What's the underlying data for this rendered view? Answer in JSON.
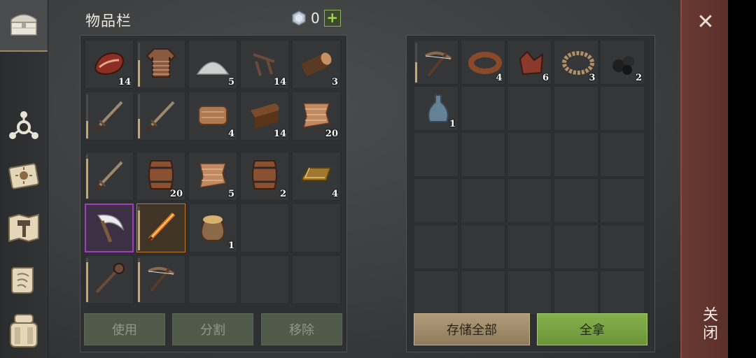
{
  "sidebar": {
    "items": [
      {
        "icon": "chest-icon"
      },
      {
        "icon": "perks-icon"
      },
      {
        "icon": "sun-journal-icon"
      },
      {
        "icon": "crafting-map-icon"
      },
      {
        "icon": "scroll-icon"
      },
      {
        "icon": "backpack-icon"
      }
    ]
  },
  "inventory": {
    "title": "物品栏",
    "currency": {
      "icon": "gem-icon",
      "value": "0",
      "add_label": "+"
    },
    "top_slots": [
      {
        "icon": "meat-icon",
        "qty": "14",
        "color": "#8a2f22"
      },
      {
        "icon": "chainmail-icon",
        "qty": "",
        "color": "#8a5a40",
        "durability": 0.6
      },
      {
        "icon": "salt-pile-icon",
        "qty": "5",
        "color": "#cfcfcf"
      },
      {
        "icon": "nails-icon",
        "qty": "14",
        "color": "#6a4a3a"
      },
      {
        "icon": "log-icon",
        "qty": "3",
        "color": "#5a3a22"
      },
      {
        "icon": "sword-icon",
        "qty": "",
        "color": "#9a8a70",
        "durability": 0.4
      },
      {
        "icon": "sword-icon",
        "qty": "",
        "color": "#9a8a70",
        "durability": 0.45
      },
      {
        "icon": "leather-icon",
        "qty": "4",
        "color": "#b07a50"
      },
      {
        "icon": "hide-roll-icon",
        "qty": "14",
        "color": "#7a4a2a"
      },
      {
        "icon": "cloth-icon",
        "qty": "20",
        "color": "#c08a60"
      }
    ],
    "bottom_slots": [
      {
        "icon": "sword-icon",
        "qty": "",
        "color": "#9a8a70",
        "durability": 0.9
      },
      {
        "icon": "barrel-icon",
        "qty": "20",
        "color": "#8a5030"
      },
      {
        "icon": "cloth-icon",
        "qty": "5",
        "color": "#c08a60"
      },
      {
        "icon": "barrel-icon",
        "qty": "2",
        "color": "#8a5030"
      },
      {
        "icon": "gold-bar-icon",
        "qty": "4",
        "color": "#a07830"
      },
      {
        "icon": "scythe-icon",
        "qty": "",
        "color": "#ececec",
        "rarity": "purple"
      },
      {
        "icon": "flaming-sword-icon",
        "qty": "",
        "color": "#e07020",
        "rarity": "orange",
        "durability": 0.9
      },
      {
        "icon": "sack-icon",
        "qty": "1",
        "color": "#8a6a48"
      },
      {
        "icon": "",
        "qty": ""
      },
      {
        "icon": "",
        "qty": ""
      },
      {
        "icon": "mace-icon",
        "qty": "",
        "color": "#6a4a3a",
        "durability": 0.9
      },
      {
        "icon": "crossbow-icon",
        "qty": "",
        "color": "#8a6a4a",
        "durability": 0.9
      },
      {
        "icon": "",
        "qty": ""
      },
      {
        "icon": "",
        "qty": ""
      },
      {
        "icon": "",
        "qty": ""
      }
    ],
    "buttons": {
      "use": "使用",
      "split": "分割",
      "remove": "移除"
    }
  },
  "storage": {
    "slots": [
      {
        "icon": "crossbow-icon",
        "qty": "",
        "color": "#8a6a4a",
        "durability": 0.5
      },
      {
        "icon": "leather-strap-icon",
        "qty": "4",
        "color": "#8a4a2a"
      },
      {
        "icon": "leather-scraps-icon",
        "qty": "6",
        "color": "#8a3a2a"
      },
      {
        "icon": "rope-icon",
        "qty": "3",
        "color": "#b09068"
      },
      {
        "icon": "coal-icon",
        "qty": "2",
        "color": "#1e1e1e"
      },
      {
        "icon": "flask-icon",
        "qty": "1",
        "color": "#6a8aa0"
      }
    ],
    "buttons": {
      "store_all": "存储全部",
      "take_all": "全拿"
    }
  },
  "close": {
    "icon": "close-icon",
    "label": "关闭"
  }
}
